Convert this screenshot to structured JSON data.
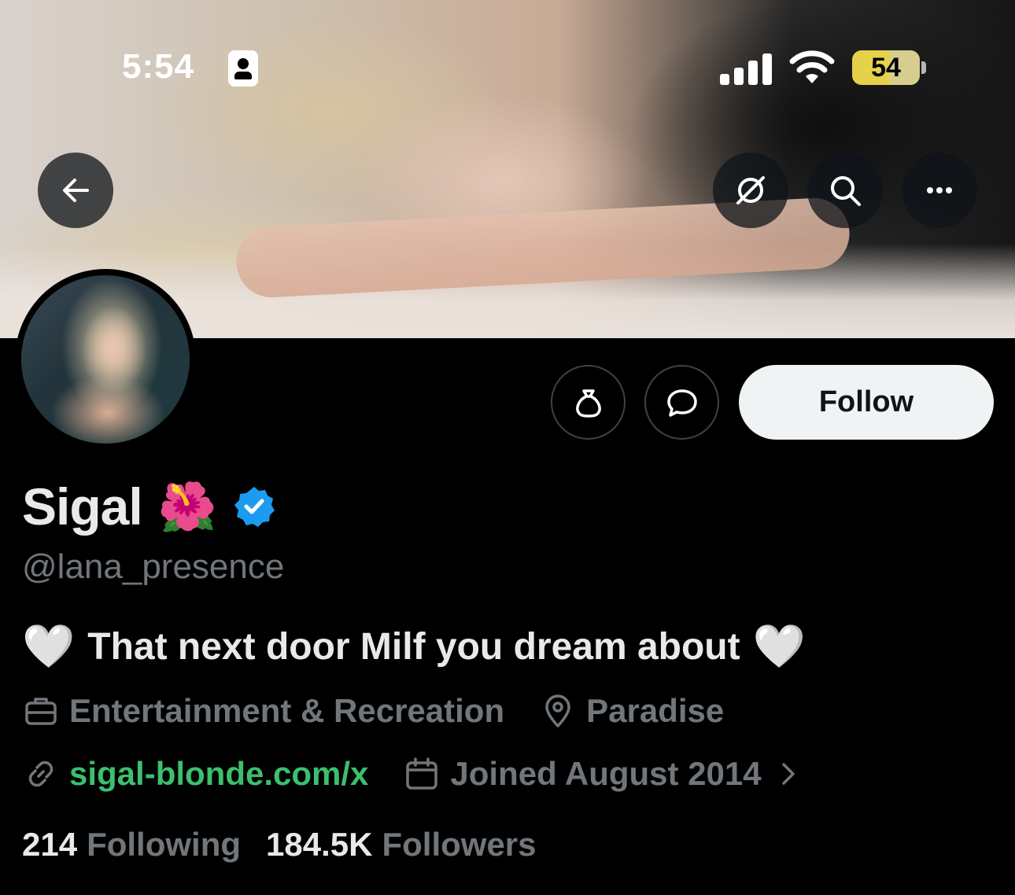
{
  "status_bar": {
    "time": "5:54",
    "battery": "54",
    "battery_color": "#e6d24a"
  },
  "banner": {
    "back_icon": "arrow-left-icon",
    "grok_icon": "slash-circle-icon",
    "search_icon": "search-icon",
    "more_icon": "more-dots-icon"
  },
  "actions": {
    "tip_icon": "money-bag-icon",
    "message_icon": "message-bubble-icon",
    "follow_label": "Follow"
  },
  "profile": {
    "display_name": "Sigal",
    "name_emoji": "🌺",
    "verified_color": "#1d9bf0",
    "handle": "@lana_presence",
    "bio_heart_left": "🤍",
    "bio": "That next door Milf you dream about",
    "bio_heart_right": "🤍",
    "category": "Entertainment & Recreation",
    "location": "Paradise",
    "website": "sigal-blonde.com/x",
    "joined": "Joined August 2014",
    "link_color": "#3cbf6e"
  },
  "stats": {
    "following_count": "214",
    "following_label": "Following",
    "followers_count": "184.5K",
    "followers_label": "Followers"
  }
}
